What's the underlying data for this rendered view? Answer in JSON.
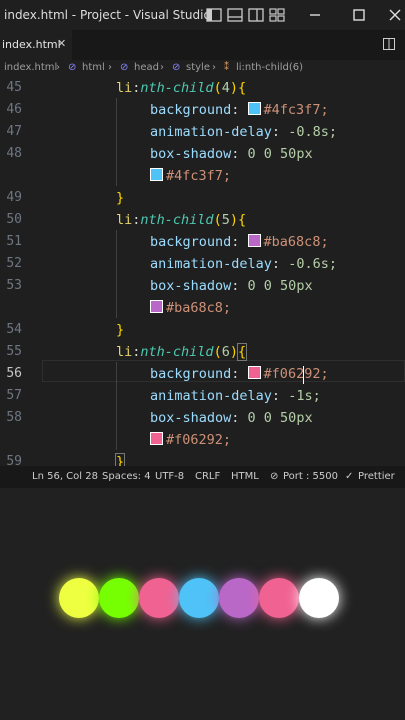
{
  "window": {
    "title": "index.html - Project - Visual Studio"
  },
  "tab": {
    "label": "index.html",
    "close": "✕"
  },
  "breadcrumb": [
    "index.html",
    "html",
    "head",
    "style",
    "li:nth-child(6)"
  ],
  "editor": {
    "line_numbers": [
      "45",
      "46",
      "47",
      "48",
      "",
      "49",
      "50",
      "51",
      "52",
      "53",
      "",
      "54",
      "55",
      "56",
      "57",
      "58",
      "",
      "59"
    ],
    "blocks": [
      {
        "nth": "4",
        "color": "#4fc3f7",
        "delay": "-0.8s"
      },
      {
        "nth": "5",
        "color": "#ba68c8",
        "delay": "-0.6s"
      },
      {
        "nth": "6",
        "color": "#f06292",
        "delay": "-1s"
      }
    ],
    "tokens": {
      "selector_li": "li",
      "colon": ":",
      "pseudo": "nth-child",
      "background": "background",
      "animation_delay": "animation-delay",
      "box_shadow": "box-shadow",
      "shadow_values": "0 0 50px",
      "open_brace": "{",
      "close_brace": "}"
    },
    "line_46_value": "#4fc3f7;",
    "line_47_value": "-0.8s;",
    "line_48b_value": "#4fc3f7;",
    "line_51_value": "#ba68c8;",
    "line_52_value": "-0.6s;",
    "line_53b_value": "#ba68c8;",
    "line_56_value_a": "#f0",
    "line_56_value_b": "6292;",
    "line_57_value": "-1s;",
    "line_58b_value": "#f06292;"
  },
  "statusbar": {
    "position": "Ln 56, Col 28",
    "spaces": "Spaces: 4",
    "encoding": "UTF-8",
    "eol": "CRLF",
    "language": "HTML",
    "port": "Port : 5500",
    "formatter": "Prettier"
  },
  "preview": {
    "balls": [
      "#eeff41",
      "#76ff03",
      "#f06292",
      "#4fc3f7",
      "#ba68c8",
      "#f06292",
      "#ffffff"
    ]
  }
}
